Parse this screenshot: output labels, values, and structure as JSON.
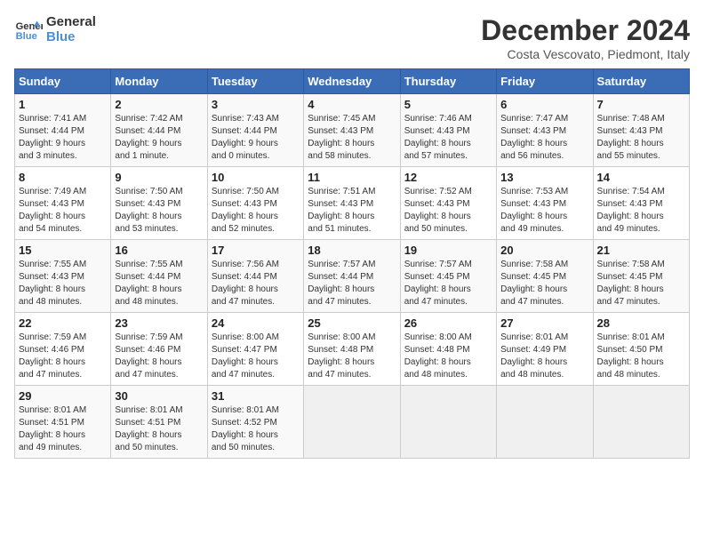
{
  "header": {
    "logo_line1": "General",
    "logo_line2": "Blue",
    "title": "December 2024",
    "subtitle": "Costa Vescovato, Piedmont, Italy"
  },
  "days_of_week": [
    "Sunday",
    "Monday",
    "Tuesday",
    "Wednesday",
    "Thursday",
    "Friday",
    "Saturday"
  ],
  "weeks": [
    [
      {
        "day": 1,
        "info": "Sunrise: 7:41 AM\nSunset: 4:44 PM\nDaylight: 9 hours\nand 3 minutes."
      },
      {
        "day": 2,
        "info": "Sunrise: 7:42 AM\nSunset: 4:44 PM\nDaylight: 9 hours\nand 1 minute."
      },
      {
        "day": 3,
        "info": "Sunrise: 7:43 AM\nSunset: 4:44 PM\nDaylight: 9 hours\nand 0 minutes."
      },
      {
        "day": 4,
        "info": "Sunrise: 7:45 AM\nSunset: 4:43 PM\nDaylight: 8 hours\nand 58 minutes."
      },
      {
        "day": 5,
        "info": "Sunrise: 7:46 AM\nSunset: 4:43 PM\nDaylight: 8 hours\nand 57 minutes."
      },
      {
        "day": 6,
        "info": "Sunrise: 7:47 AM\nSunset: 4:43 PM\nDaylight: 8 hours\nand 56 minutes."
      },
      {
        "day": 7,
        "info": "Sunrise: 7:48 AM\nSunset: 4:43 PM\nDaylight: 8 hours\nand 55 minutes."
      }
    ],
    [
      {
        "day": 8,
        "info": "Sunrise: 7:49 AM\nSunset: 4:43 PM\nDaylight: 8 hours\nand 54 minutes."
      },
      {
        "day": 9,
        "info": "Sunrise: 7:50 AM\nSunset: 4:43 PM\nDaylight: 8 hours\nand 53 minutes."
      },
      {
        "day": 10,
        "info": "Sunrise: 7:50 AM\nSunset: 4:43 PM\nDaylight: 8 hours\nand 52 minutes."
      },
      {
        "day": 11,
        "info": "Sunrise: 7:51 AM\nSunset: 4:43 PM\nDaylight: 8 hours\nand 51 minutes."
      },
      {
        "day": 12,
        "info": "Sunrise: 7:52 AM\nSunset: 4:43 PM\nDaylight: 8 hours\nand 50 minutes."
      },
      {
        "day": 13,
        "info": "Sunrise: 7:53 AM\nSunset: 4:43 PM\nDaylight: 8 hours\nand 49 minutes."
      },
      {
        "day": 14,
        "info": "Sunrise: 7:54 AM\nSunset: 4:43 PM\nDaylight: 8 hours\nand 49 minutes."
      }
    ],
    [
      {
        "day": 15,
        "info": "Sunrise: 7:55 AM\nSunset: 4:43 PM\nDaylight: 8 hours\nand 48 minutes."
      },
      {
        "day": 16,
        "info": "Sunrise: 7:55 AM\nSunset: 4:44 PM\nDaylight: 8 hours\nand 48 minutes."
      },
      {
        "day": 17,
        "info": "Sunrise: 7:56 AM\nSunset: 4:44 PM\nDaylight: 8 hours\nand 47 minutes."
      },
      {
        "day": 18,
        "info": "Sunrise: 7:57 AM\nSunset: 4:44 PM\nDaylight: 8 hours\nand 47 minutes."
      },
      {
        "day": 19,
        "info": "Sunrise: 7:57 AM\nSunset: 4:45 PM\nDaylight: 8 hours\nand 47 minutes."
      },
      {
        "day": 20,
        "info": "Sunrise: 7:58 AM\nSunset: 4:45 PM\nDaylight: 8 hours\nand 47 minutes."
      },
      {
        "day": 21,
        "info": "Sunrise: 7:58 AM\nSunset: 4:45 PM\nDaylight: 8 hours\nand 47 minutes."
      }
    ],
    [
      {
        "day": 22,
        "info": "Sunrise: 7:59 AM\nSunset: 4:46 PM\nDaylight: 8 hours\nand 47 minutes."
      },
      {
        "day": 23,
        "info": "Sunrise: 7:59 AM\nSunset: 4:46 PM\nDaylight: 8 hours\nand 47 minutes."
      },
      {
        "day": 24,
        "info": "Sunrise: 8:00 AM\nSunset: 4:47 PM\nDaylight: 8 hours\nand 47 minutes."
      },
      {
        "day": 25,
        "info": "Sunrise: 8:00 AM\nSunset: 4:48 PM\nDaylight: 8 hours\nand 47 minutes."
      },
      {
        "day": 26,
        "info": "Sunrise: 8:00 AM\nSunset: 4:48 PM\nDaylight: 8 hours\nand 48 minutes."
      },
      {
        "day": 27,
        "info": "Sunrise: 8:01 AM\nSunset: 4:49 PM\nDaylight: 8 hours\nand 48 minutes."
      },
      {
        "day": 28,
        "info": "Sunrise: 8:01 AM\nSunset: 4:50 PM\nDaylight: 8 hours\nand 48 minutes."
      }
    ],
    [
      {
        "day": 29,
        "info": "Sunrise: 8:01 AM\nSunset: 4:51 PM\nDaylight: 8 hours\nand 49 minutes."
      },
      {
        "day": 30,
        "info": "Sunrise: 8:01 AM\nSunset: 4:51 PM\nDaylight: 8 hours\nand 50 minutes."
      },
      {
        "day": 31,
        "info": "Sunrise: 8:01 AM\nSunset: 4:52 PM\nDaylight: 8 hours\nand 50 minutes."
      },
      null,
      null,
      null,
      null
    ]
  ]
}
